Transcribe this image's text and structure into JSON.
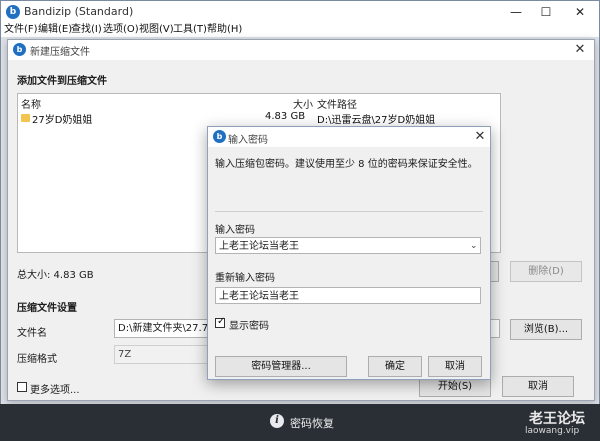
{
  "app": {
    "title": "Bandizip (Standard)"
  },
  "window_controls": {
    "minimize": "—",
    "maximize": "☐",
    "close": "✕"
  },
  "menu": [
    "文件(F)",
    "编辑(E)",
    "查找(I)",
    "选项(O)",
    "视图(V)",
    "工具(T)",
    "帮助(H)"
  ],
  "new_archive": {
    "title": "新建压缩文件",
    "add_section": "添加文件到压缩文件",
    "columns": {
      "name": "名称",
      "size": "大小",
      "path": "文件路径"
    },
    "files": [
      {
        "name": "27岁D奶姐姐",
        "size": "4.83 GB",
        "path": "D:\\迅雷云盘\\27岁D奶姐姐"
      }
    ],
    "total_size": "总大小: 4.83 GB",
    "delete_button": "删除(D)",
    "settings_section": "压缩文件设置",
    "filename_label": "文件名",
    "filename_value": "D:\\新建文件夹\\27.7z",
    "browse_button": "浏览(B)...",
    "format_label": "压缩格式",
    "format_value": "7Z",
    "more_options": "更多选项...",
    "start_button": "开始(S)",
    "cancel_button": "取消"
  },
  "password_dialog": {
    "title": "输入密码",
    "hint": "输入压缩包密码。建议使用至少 8 位的密码来保证安全性。",
    "enter_label": "输入密码",
    "enter_value": "上老王论坛当老王",
    "reenter_label": "重新输入密码",
    "reenter_value": "上老王论坛当老王",
    "show_password": "显示密码",
    "show_password_checked": true,
    "manager_button": "密码管理器...",
    "ok_button": "确定",
    "cancel_button": "取消"
  },
  "taskbar": {
    "label": "密码恢复"
  },
  "watermark": {
    "line1": "老王论坛",
    "line2": "laowang.vip"
  },
  "icons": {
    "app": "bandizip-icon",
    "folder": "folder-icon",
    "info": "info-icon",
    "dropdown": "chevron-down-icon",
    "check": "checkmark-icon"
  }
}
